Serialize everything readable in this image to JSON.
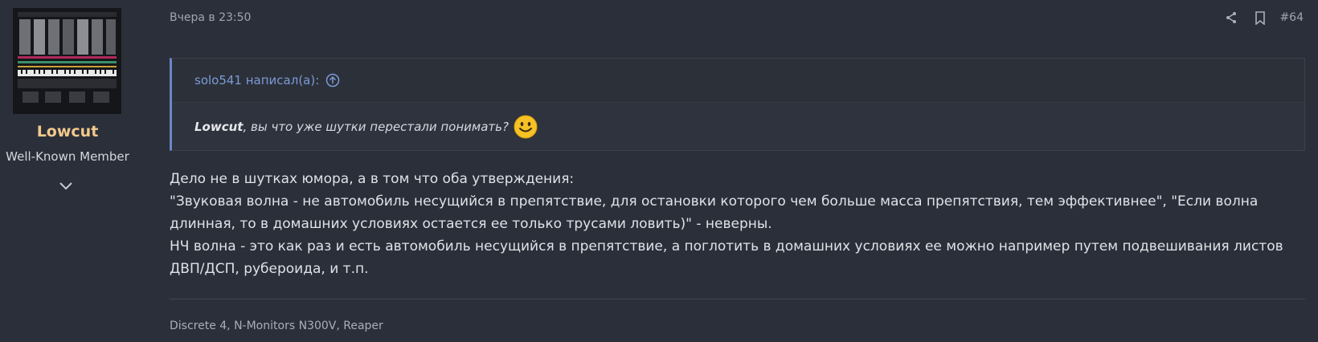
{
  "author": {
    "username": "Lowcut",
    "title": "Well-Known Member",
    "avatar_icon": "avatar-synth-icon",
    "username_color": "#f3c98b"
  },
  "post": {
    "date": "Вчера в 23:50",
    "number": "#64",
    "share_icon": "share-icon",
    "bookmark_icon": "bookmark-icon"
  },
  "quote": {
    "author_line": "solo541 написал(а):",
    "mention": "Lowcut",
    "text": ", вы что уже шутки перестали понимать?",
    "accent_color": "#6b86c8"
  },
  "body": {
    "lines": [
      "Дело не в шутках юмора, а в том что оба утверждения:",
      "\"Звуковая волна - не автомобиль несущийся в препятствие, для остановки которого чем больше масса препятствия, тем эффективнее\", \"Если волна длинная, то в домашних условиях остается ее только трусами ловить)\" - неверны.",
      "НЧ волна - это как раз и есть автомобиль несущийся в препятствие, а поглотить в домашних условиях ее можно например путем подвешивания листов ДВП/ДСП, рубероида, и т.п."
    ]
  },
  "signature": {
    "text": "Discrete 4, N-Monitors N300V, Reaper"
  }
}
